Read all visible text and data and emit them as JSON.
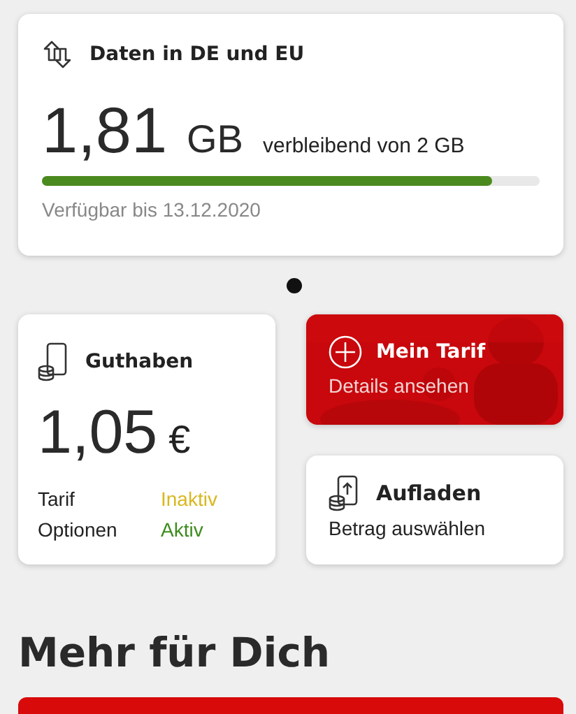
{
  "data_card": {
    "title": "Daten in DE und EU",
    "amount": "1,81",
    "unit": "GB",
    "remaining": "verbleibend von 2 GB",
    "level": 0.905,
    "valid_until": "Verfügbar bis 13.12.2020"
  },
  "pager": [
    {
      "selected": true
    }
  ],
  "balance_card": {
    "title": "Guthaben",
    "amount": "1,05",
    "currency": "€",
    "rows": [
      {
        "label": "Tarif",
        "status": "Inaktiv",
        "color": "#d8b820"
      },
      {
        "label": "Optionen",
        "status": "Aktiv",
        "color": "#3d8c1e"
      }
    ]
  },
  "tariff_card": {
    "title": "Mein Tarif",
    "subtitle": "Details ansehen"
  },
  "topup_card": {
    "title": "Aufladen",
    "subtitle": "Betrag auswählen"
  },
  "section_title": "Mehr für Dich"
}
